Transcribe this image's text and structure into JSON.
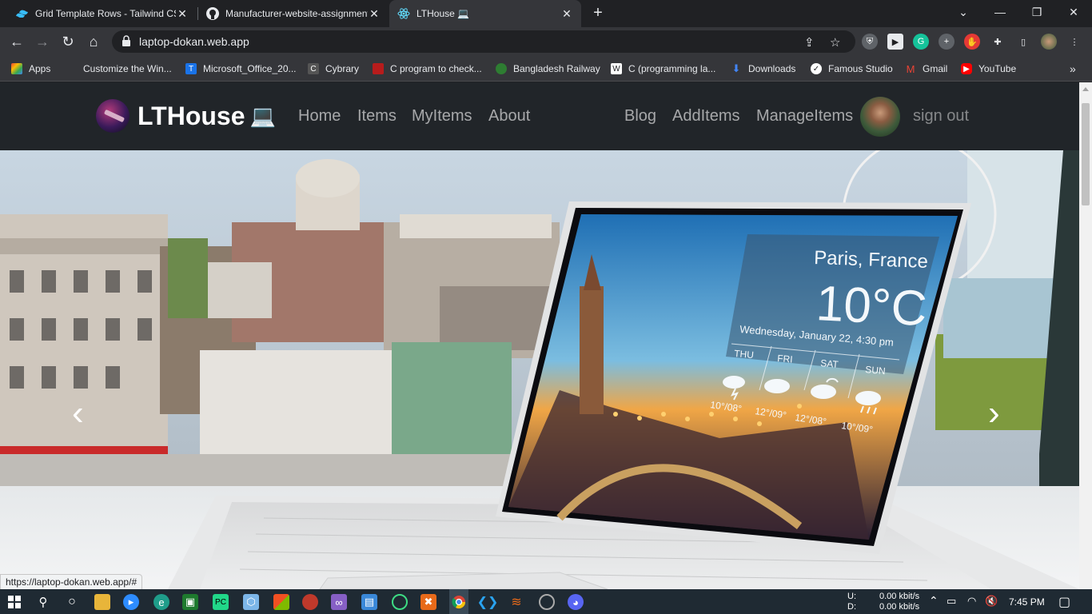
{
  "tabs": [
    {
      "title": "Grid Template Rows - Tailwind CSS",
      "icon": "tailwind-icon"
    },
    {
      "title": "Manufacturer-website-assignment",
      "icon": "github-icon"
    },
    {
      "title": "LTHouse 💻",
      "icon": "react-icon"
    }
  ],
  "address": {
    "url": "laptop-dokan.web.app"
  },
  "bookmarks": [
    {
      "label": "Apps",
      "color": "#e8453c"
    },
    {
      "label": "Customize the Win...",
      "color": "#35363a"
    },
    {
      "label": "Microsoft_Office_20...",
      "color": "#1a73e8"
    },
    {
      "label": "Cybrary",
      "color": "#555555"
    },
    {
      "label": "C program to check...",
      "color": "#b71c1c"
    },
    {
      "label": "Bangladesh Railway",
      "color": "#2e7d32"
    },
    {
      "label": "C (programming la...",
      "color": "#ffffff"
    },
    {
      "label": "Downloads",
      "color": "#1a73e8"
    },
    {
      "label": "Famous Studio",
      "color": "#ffffff"
    },
    {
      "label": "Gmail",
      "color": "#ea4335"
    },
    {
      "label": "YouTube",
      "color": "#ff0000"
    }
  ],
  "site": {
    "brand": "LTHouse",
    "brand_emoji": "💻",
    "nav_left": [
      "Home",
      "Items",
      "MyItems",
      "About"
    ],
    "nav_right": [
      "Blog",
      "AddItems",
      "ManageItems"
    ],
    "signout": "sign out"
  },
  "screen_widget": {
    "city": "Paris, France",
    "temp": "10°C",
    "date": "Wednesday, January 22, 4:30 pm",
    "days": [
      "THU",
      "FRI",
      "SAT",
      "SUN"
    ],
    "temps": [
      "10°/08°",
      "12°/09°",
      "12°/08°",
      "10°/09°"
    ]
  },
  "carousel": {
    "prev": "‹",
    "next": "›"
  },
  "status_url": "https://laptop-dokan.web.app/#",
  "taskbar": {
    "net_up_label": "U:",
    "net_down_label": "D:",
    "net_up": "0.00 kbit/s",
    "net_down": "0.00 kbit/s",
    "time": "7:45 PM"
  },
  "colors": {
    "navbar": "#212529",
    "tabbar": "#202124",
    "toolbar": "#35363a"
  }
}
